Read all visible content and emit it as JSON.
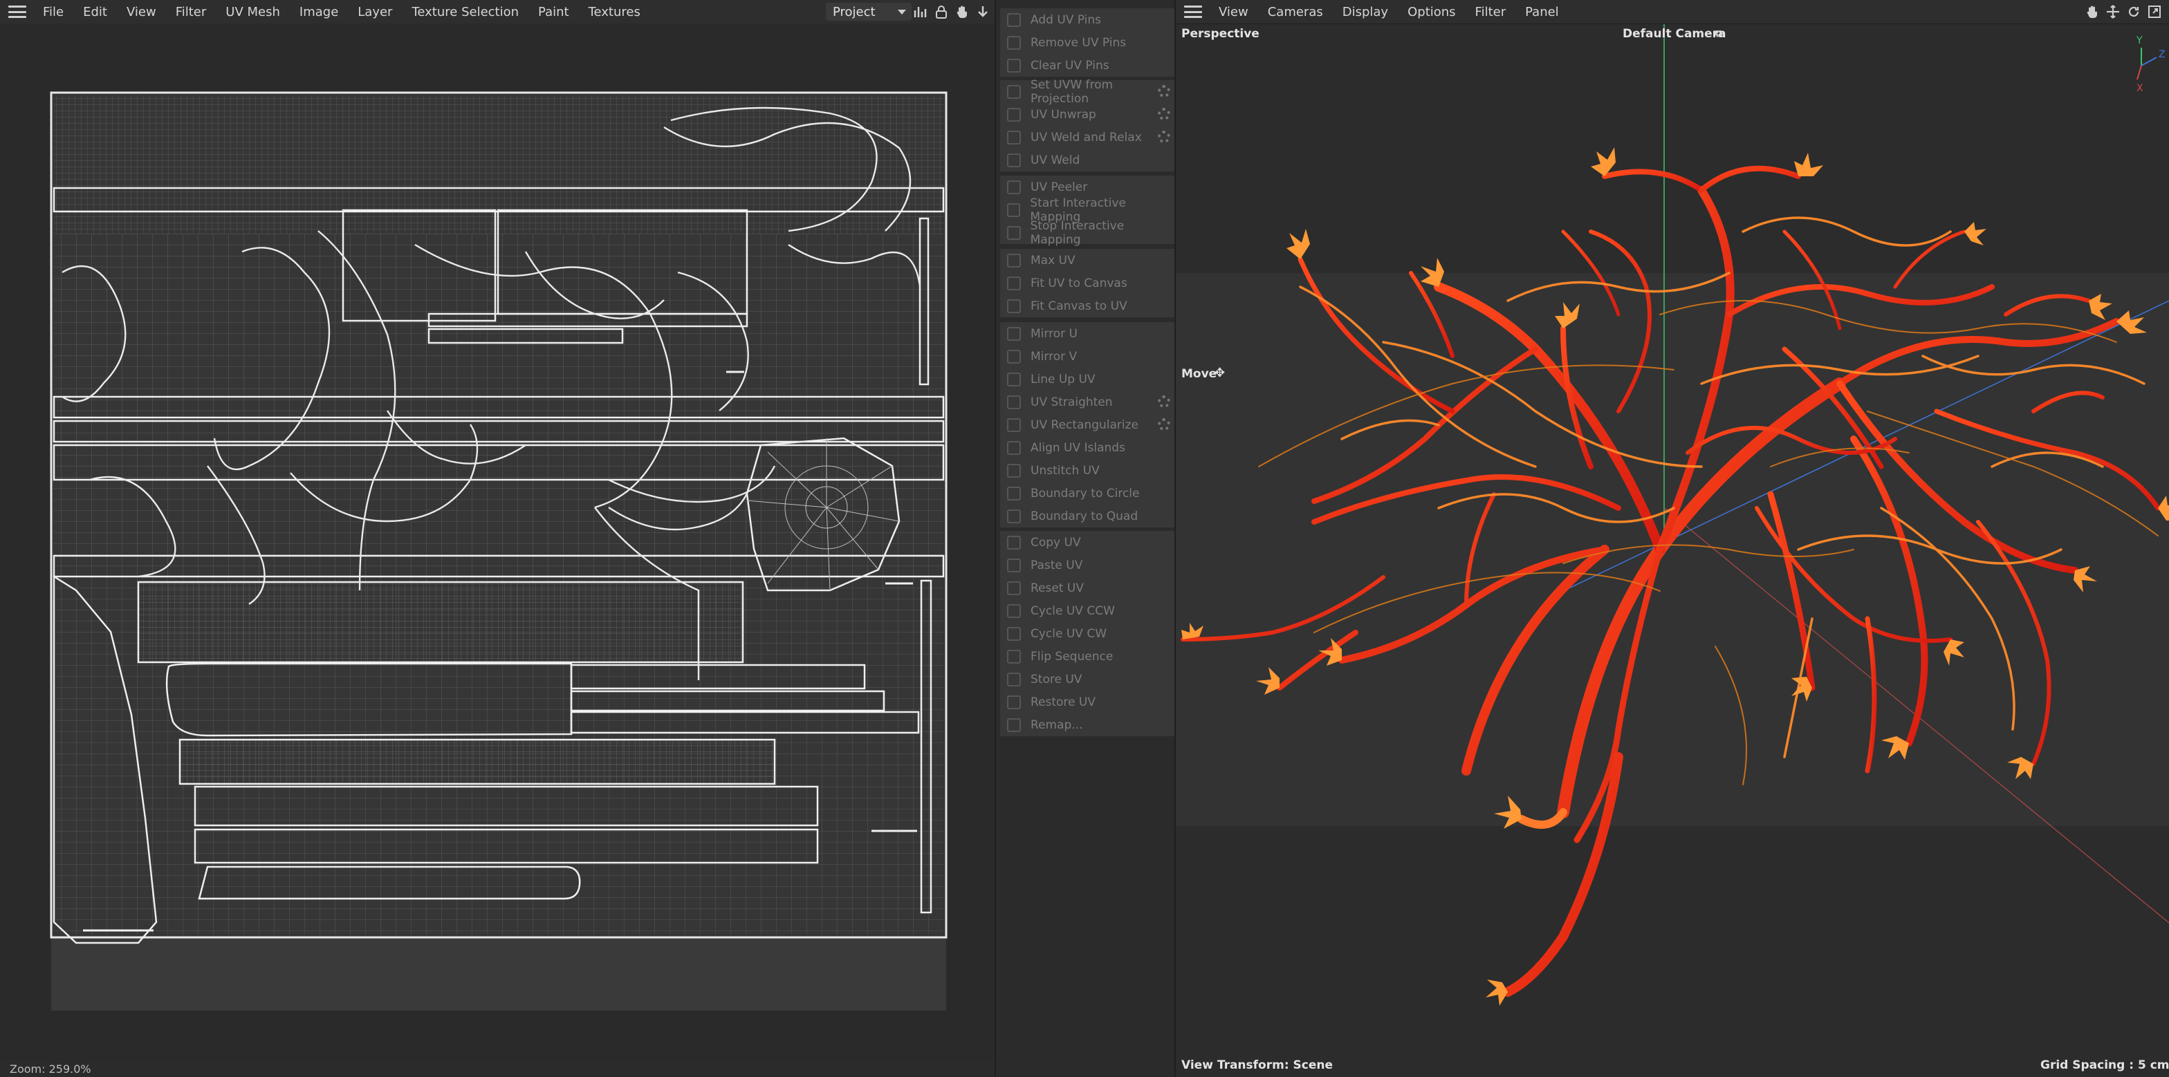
{
  "uv_editor": {
    "menu": [
      "File",
      "Edit",
      "View",
      "Filter",
      "UV Mesh",
      "Image",
      "Layer",
      "Texture Selection",
      "Paint",
      "Textures"
    ],
    "project_select": "Project",
    "status": "Zoom: 259.0%"
  },
  "uv_commands": {
    "groups": [
      [
        "Add UV Pins",
        "Remove UV Pins",
        "Clear UV Pins"
      ],
      [
        "Set UVW from Projection",
        "UV Unwrap",
        "UV Weld and Relax",
        "UV Weld"
      ],
      [
        "UV Peeler",
        "Start Interactive Mapping",
        "Stop Interactive Mapping"
      ],
      [
        "Max UV",
        "Fit UV to Canvas",
        "Fit Canvas to UV"
      ],
      [
        "Mirror U",
        "Mirror V",
        "Line Up UV",
        "UV Straighten",
        "UV Rectangularize",
        "Align UV Islands",
        "Unstitch UV",
        "Boundary to Circle",
        "Boundary to Quad"
      ],
      [
        "Copy UV",
        "Paste UV",
        "Reset UV",
        "Cycle UV CCW",
        "Cycle UV CW",
        "Flip Sequence",
        "Store UV",
        "Restore UV",
        "Remap..."
      ]
    ]
  },
  "viewport": {
    "menu": [
      "View",
      "Cameras",
      "Display",
      "Options",
      "Filter",
      "Panel"
    ],
    "view_name": "Perspective",
    "camera": "Default Camera",
    "tool": "Move",
    "view_transform": "View Transform: Scene",
    "grid_spacing": "Grid Spacing : 5 cm",
    "axis_labels": [
      "Y",
      "Z",
      "X"
    ]
  }
}
